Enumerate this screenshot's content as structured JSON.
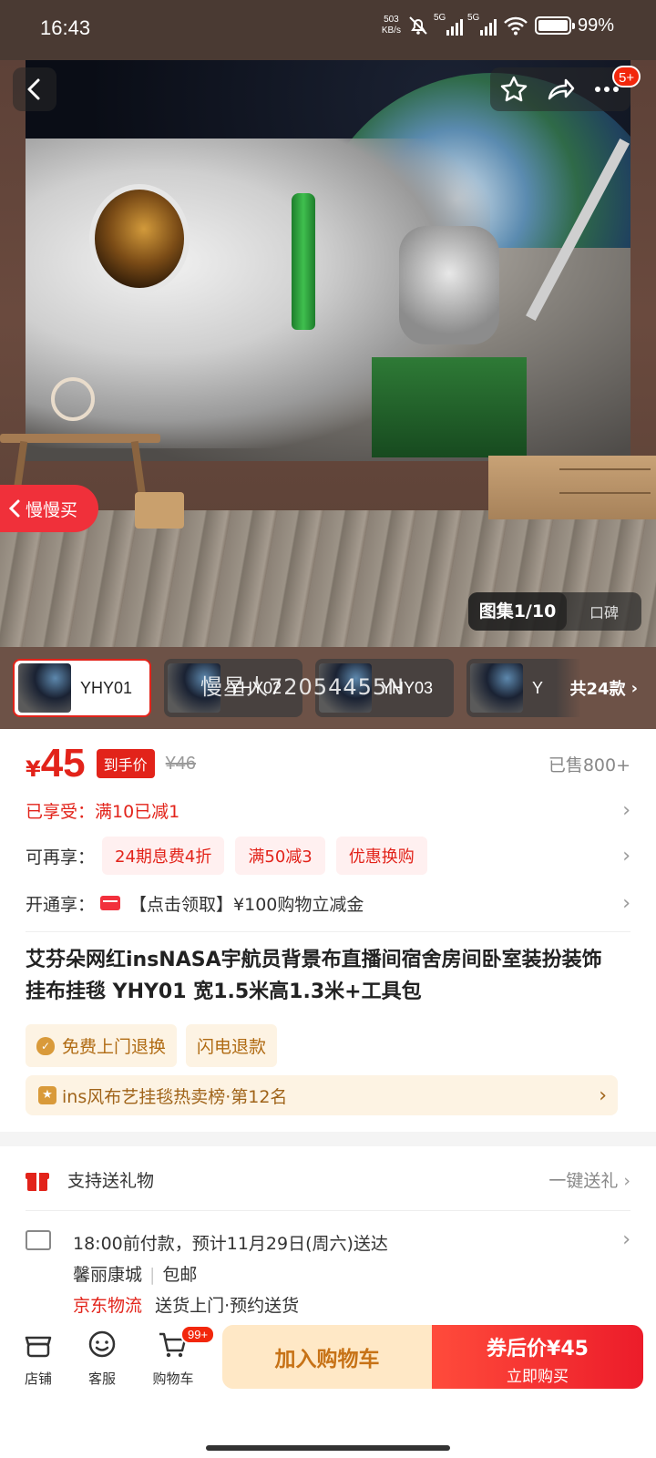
{
  "status_bar": {
    "time": "16:43",
    "net_speed_top": "503",
    "net_speed_bottom": "KB/s",
    "network1": "5G",
    "network2": "5G",
    "battery_pct": "99%",
    "battery_level": 0.99
  },
  "hero": {
    "top_badge": "5+",
    "slow_buy_label": "慢慢买",
    "gallery_label": "图集1/10",
    "reviews_label": "口碑",
    "watermark": "慢星人72054455N"
  },
  "variants": {
    "items": [
      {
        "label": "YHY01",
        "selected": true
      },
      {
        "label": "YHY02",
        "selected": false
      },
      {
        "label": "YHY03",
        "selected": false
      },
      {
        "label": "Y",
        "selected": false
      }
    ],
    "count_label": "共24款"
  },
  "price": {
    "symbol": "¥",
    "value": "45",
    "tag": "到手价",
    "original": "¥46",
    "sold": "已售800+"
  },
  "promos": {
    "enjoyed": "已享受：满10已减1",
    "more_label": "可再享：",
    "chips": [
      "24期息费4折",
      "满50减3",
      "优惠换购"
    ],
    "open_label": "开通享：",
    "open_offer": "【点击领取】¥100购物立减金"
  },
  "product": {
    "title": "艾芬朵网红insNASA宇航员背景布直播间宿舍房间卧室装扮装饰挂布挂毯 YHY01 宽1.5米高1.3米+工具包",
    "services": [
      "免费上门退换",
      "闪电退款"
    ],
    "rank": "ins风布艺挂毯热卖榜·第12名"
  },
  "gift": {
    "label": "支持送礼物",
    "action": "一键送礼"
  },
  "delivery": {
    "line1": "18:00前付款，预计11月29日(周六)送达",
    "city": "馨丽康城",
    "shipping": "包邮",
    "carrier": "京东物流",
    "carrier_note": "送货上门·预约送货"
  },
  "bottom_bar": {
    "store": "店铺",
    "service": "客服",
    "cart": "购物车",
    "cart_badge": "99+",
    "add_to_cart": "加入购物车",
    "buy_price": "券后价¥45",
    "buy_now": "立即购买"
  },
  "colors": {
    "accent_red": "#e2231a",
    "gold": "#c77216"
  }
}
